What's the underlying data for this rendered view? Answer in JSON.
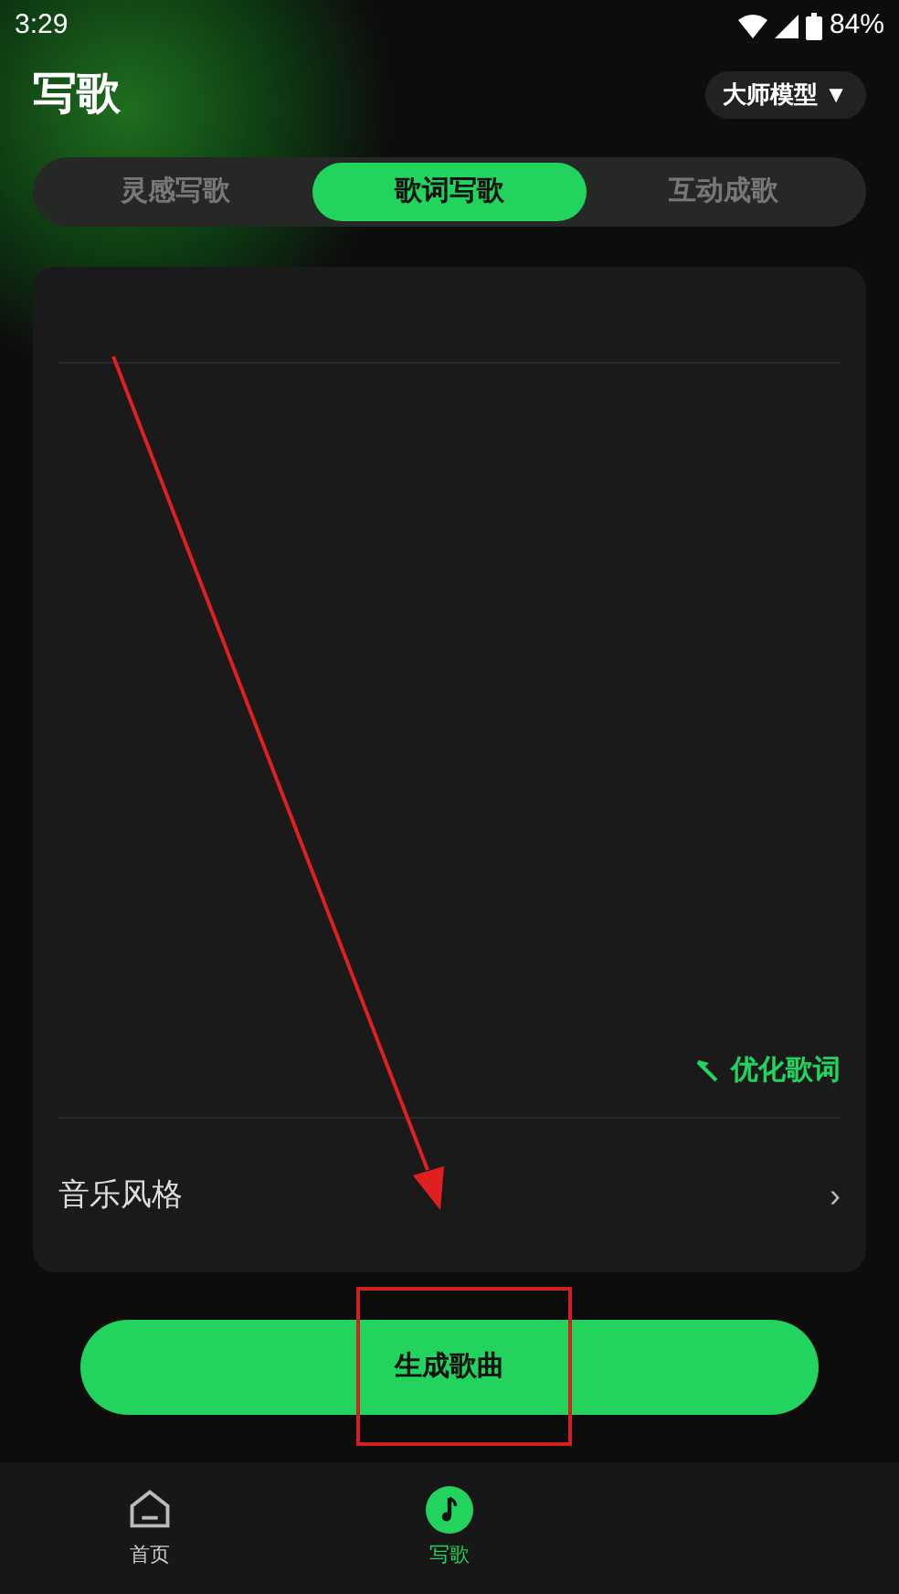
{
  "status_bar": {
    "time": "3:29",
    "battery": "84%"
  },
  "header": {
    "title": "写歌",
    "model_button": "大师模型 ▼"
  },
  "tabs": [
    {
      "label": "灵感写歌",
      "selected": false
    },
    {
      "label": "歌词写歌",
      "selected": true
    },
    {
      "label": "互动成歌",
      "selected": false
    }
  ],
  "editor": {
    "optimize_button": "优化歌词"
  },
  "music_style": {
    "label": "音乐风格",
    "chevron": "›"
  },
  "generate_button": "生成歌曲",
  "bottom_nav": [
    {
      "label": "首页",
      "kind": "home",
      "selected": false
    },
    {
      "label": "写歌",
      "kind": "write",
      "selected": true
    }
  ]
}
